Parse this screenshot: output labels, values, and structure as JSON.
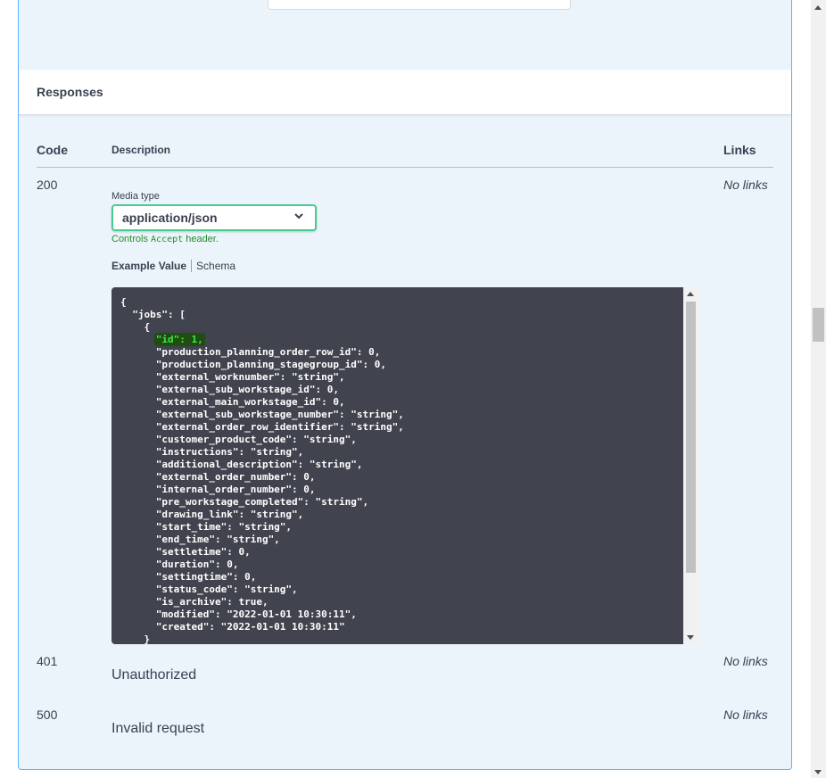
{
  "responses": {
    "title": "Responses",
    "columns": {
      "code": "Code",
      "description": "Description",
      "links": "Links"
    },
    "items": [
      {
        "code": "200",
        "links": "No links"
      },
      {
        "code": "401",
        "description": "Unauthorized",
        "links": "No links"
      },
      {
        "code": "500",
        "description": "Invalid request",
        "links": "No links"
      }
    ],
    "media_type_label": "Media type",
    "media_type_value": "application/json",
    "controls_prefix": "Controls ",
    "controls_code": "Accept",
    "controls_suffix": " header.",
    "tabs": {
      "example_value": "Example Value",
      "schema": "Schema"
    },
    "example_json_open": "{\n  \"jobs\": [\n    {\n      ",
    "example_json_highlight": "\"id\": 1,",
    "example_json_rest": "\n      \"production_planning_order_row_id\": 0,\n      \"production_planning_stagegroup_id\": 0,\n      \"external_worknumber\": \"string\",\n      \"external_sub_workstage_id\": 0,\n      \"external_main_workstage_id\": 0,\n      \"external_sub_workstage_number\": \"string\",\n      \"external_order_row_identifier\": \"string\",\n      \"customer_product_code\": \"string\",\n      \"instructions\": \"string\",\n      \"additional_description\": \"string\",\n      \"external_order_number\": 0,\n      \"internal_order_number\": 0,\n      \"pre_workstage_completed\": \"string\",\n      \"drawing_link\": \"string\",\n      \"start_time\": \"string\",\n      \"end_time\": \"string\",\n      \"settletime\": 0,\n      \"duration\": 0,\n      \"settingtime\": 0,\n      \"status_code\": \"string\",\n      \"is_archive\": true,\n      \"modified\": \"2022-01-01 10:30:11\",\n      \"created\": \"2022-01-01 10:30:11\"\n    }"
  },
  "colors": {
    "panel_bg": "#ebf3fb",
    "panel_border": "#61affe",
    "code_bg": "#41444e",
    "highlight_bg": "#1f4d12",
    "highlight_text": "#3eea3e",
    "select_border": "#49cc90",
    "controls_text": "#248f24"
  }
}
